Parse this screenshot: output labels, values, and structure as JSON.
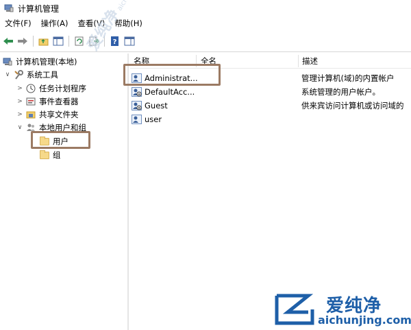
{
  "window": {
    "title": "计算机管理"
  },
  "menu": [
    "文件(F)",
    "操作(A)",
    "查看(V)",
    "帮助(H)"
  ],
  "toolbar": {
    "buttons": [
      "back-arrow-icon",
      "forward-arrow-icon",
      "up-folder-icon",
      "console-tree-icon",
      "refresh-icon",
      "export-list-icon",
      "help-icon",
      "action-pane-icon"
    ]
  },
  "tree": {
    "root": "计算机管理(本地)",
    "system_tools": "系统工具",
    "task_scheduler": "任务计划程序",
    "event_viewer": "事件查看器",
    "shared_folders": "共享文件夹",
    "local_users_groups": "本地用户和组",
    "users": "用户",
    "groups": "组"
  },
  "list": {
    "columns": {
      "name": "名称",
      "fullname": "全名",
      "description": "描述"
    },
    "rows": [
      {
        "name": "Administrat...",
        "description": "管理计算机(域)的内置帐户"
      },
      {
        "name": "DefaultAcc...",
        "description": "系统管理的用户帐户。"
      },
      {
        "name": "Guest",
        "description": "供来宾访问计算机或访问域的"
      },
      {
        "name": "user",
        "description": ""
      }
    ]
  },
  "colors": {
    "highlight": "#9b7a63",
    "logo": "#1e5fa8",
    "watermark": "#c9d6e6"
  },
  "watermark": {
    "text": "爱纯净",
    "url": "aichunjing.com"
  },
  "logo": {
    "text": "爱纯净",
    "url": "aichunjing.com"
  }
}
